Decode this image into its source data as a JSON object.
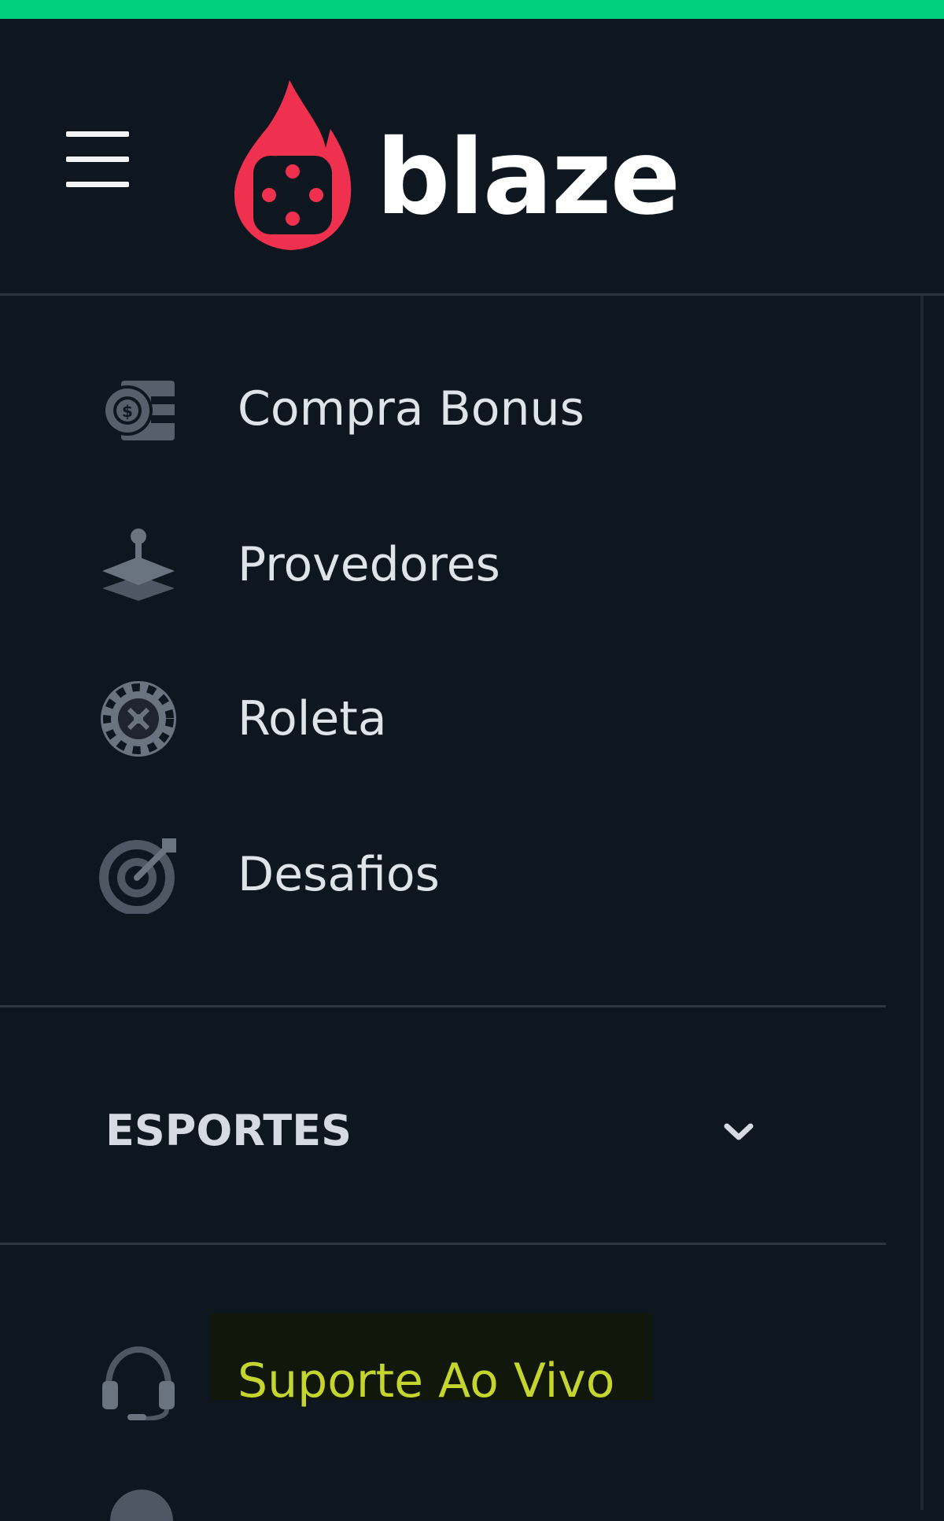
{
  "brand": {
    "name": "blaze",
    "accent_color": "#00d17c",
    "logo_color": "#f0304f"
  },
  "header": {
    "menu_icon": "hamburger-menu-icon"
  },
  "menu": {
    "items": [
      {
        "label": "Compra Bonus",
        "icon": "coin-card-icon"
      },
      {
        "label": "Provedores",
        "icon": "joystick-layers-icon"
      },
      {
        "label": "Roleta",
        "icon": "roulette-chip-icon"
      },
      {
        "label": "Desafios",
        "icon": "target-arrow-icon"
      }
    ]
  },
  "sports_section": {
    "label": "ESPORTES",
    "state": "collapsed",
    "icon": "chevron-down-icon"
  },
  "support": {
    "label": "Suporte Ao Vivo",
    "icon": "headset-icon",
    "highlight_color": "#c4d52e"
  }
}
